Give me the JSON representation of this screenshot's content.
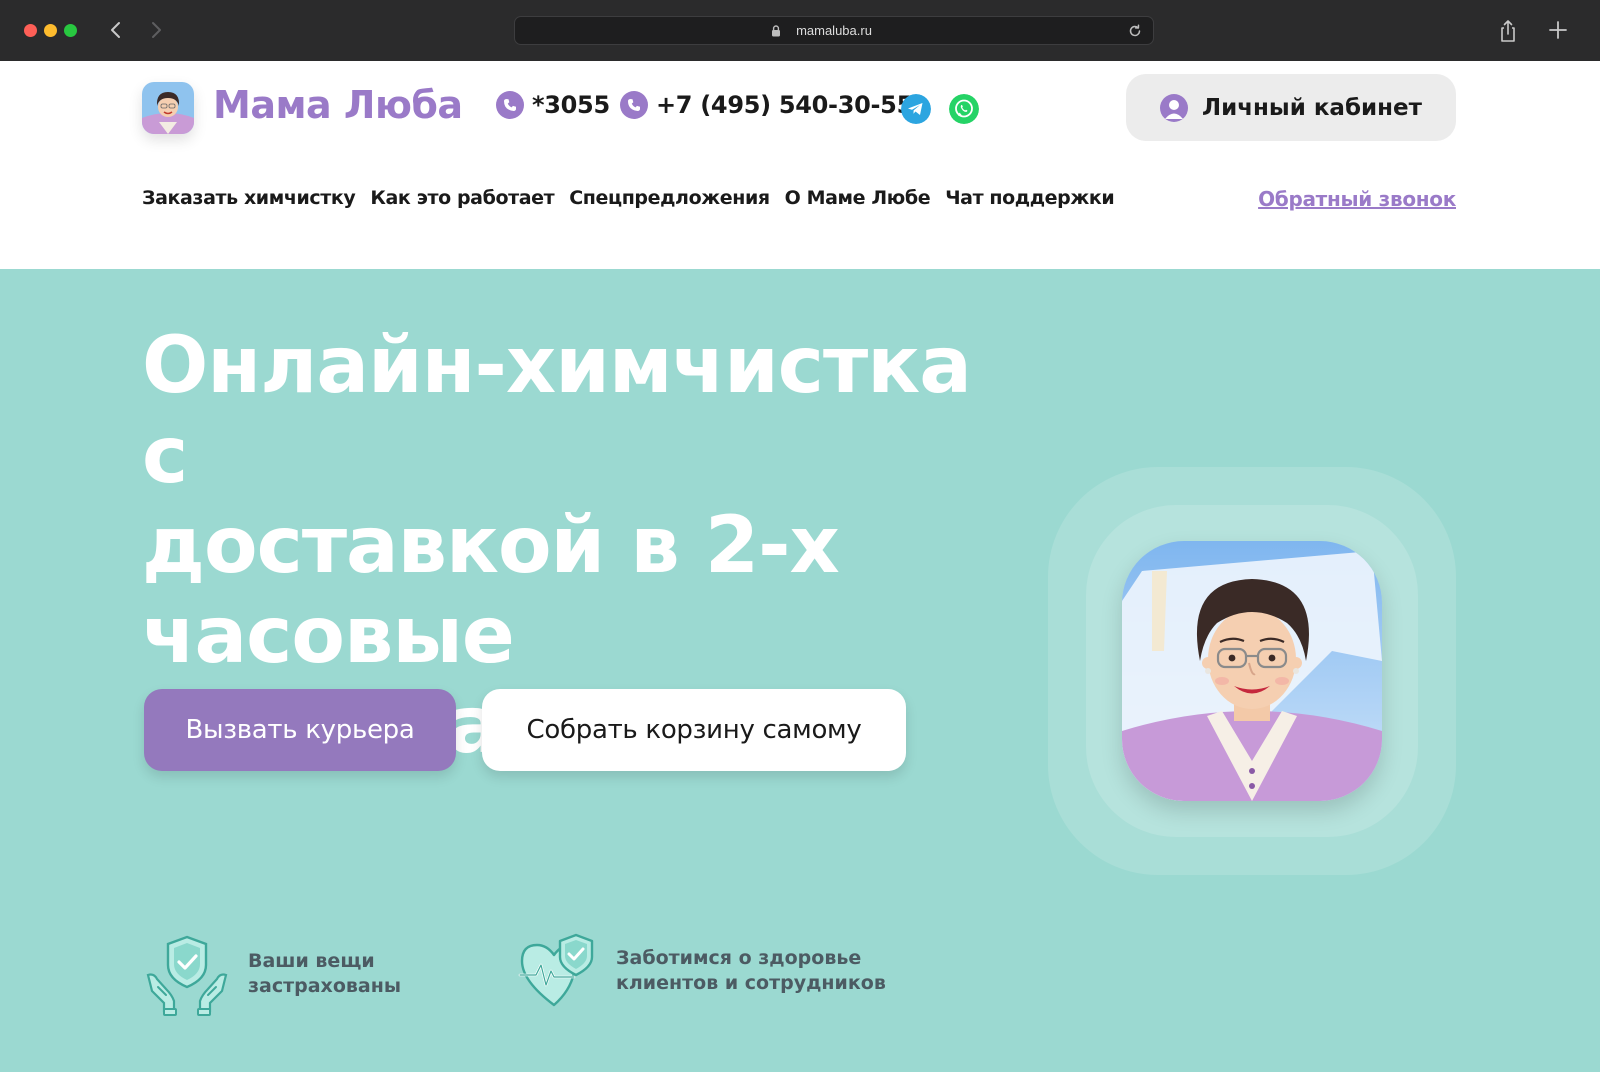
{
  "browser": {
    "url": "mamaluba.ru"
  },
  "header": {
    "brand": "Мама Люба",
    "phone_short": "*3055",
    "phone_full": "+7 (495) 540-30-55",
    "account_label": "Личный кабинет",
    "menu": [
      {
        "label": "Заказать химчистку"
      },
      {
        "label": "Как это работает"
      },
      {
        "label": "Спецпредложения"
      },
      {
        "label": "О Маме Любе"
      },
      {
        "label": "Чат поддержки"
      }
    ],
    "callback_label": "Обратный звонок",
    "social": [
      {
        "icon": "telegram-icon",
        "color": "#2ca5e0"
      },
      {
        "icon": "whatsapp-icon",
        "color": "#25d366"
      }
    ]
  },
  "hero": {
    "title_lines": [
      "Онлайн-химчистка с",
      "доставкой в 2-х",
      "часовые интервалы"
    ],
    "cta_primary": "Вызвать курьера",
    "cta_secondary": "Собрать корзину самому"
  },
  "features": [
    {
      "icon": "insurance-hands-icon",
      "lines": [
        "Ваши вещи",
        "застрахованы"
      ]
    },
    {
      "icon": "heart-shield-icon",
      "lines": [
        "Заботимся о здоровье",
        "клиентов и сотрудников"
      ]
    }
  ],
  "colors": {
    "brand_purple": "#9a7ac8",
    "hero_bg": "#9bd9d1",
    "button_purple": "#9479bd"
  }
}
